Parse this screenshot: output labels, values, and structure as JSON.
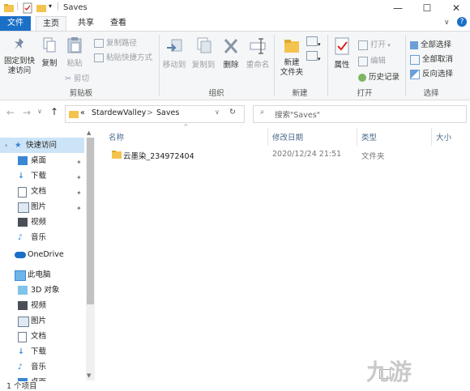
{
  "window": {
    "title": "Saves",
    "controls": {
      "minimize": "—",
      "maximize": "☐",
      "close": "✕"
    }
  },
  "tabs": {
    "file": "文件",
    "home": "主页",
    "share": "共享",
    "view": "查看"
  },
  "ribbon": {
    "clipboard": {
      "pin": "固定到快\n速访问",
      "copy": "复制",
      "paste": "粘贴",
      "copy_path": "复制路径",
      "paste_shortcut": "粘贴快捷方式",
      "cut": "剪切",
      "group": "剪贴板"
    },
    "organize": {
      "move_to": "移动到",
      "copy_to": "复制到",
      "delete": "删除",
      "rename": "重命名",
      "group": "组织"
    },
    "new": {
      "new_folder": "新建\n文件夹",
      "group": "新建"
    },
    "open": {
      "properties": "属性",
      "open": "打开",
      "edit": "编辑",
      "history": "历史记录",
      "group": "打开"
    },
    "select": {
      "select_all": "全部选择",
      "select_none": "全部取消",
      "invert": "反向选择",
      "group": "选择"
    }
  },
  "address": {
    "prefix": "«",
    "crumbs": [
      "StardewValley",
      "Saves"
    ],
    "separator": ">"
  },
  "search": {
    "placeholder": "搜索\"Saves\""
  },
  "nav": {
    "quick_access": "快速访问",
    "quick_items": [
      "桌面",
      "下载",
      "文档",
      "图片",
      "视频",
      "音乐"
    ],
    "onedrive": "OneDrive",
    "this_pc": "此电脑",
    "pc_items": [
      "3D 对象",
      "视频",
      "图片",
      "文档",
      "下载",
      "音乐",
      "桌面"
    ]
  },
  "columns": {
    "name": "名称",
    "modified": "修改日期",
    "type": "类型",
    "size": "大小"
  },
  "files": [
    {
      "name": "云墨染_234972404",
      "modified": "2020/12/24 21:51",
      "type": "文件夹",
      "size": ""
    }
  ],
  "status": {
    "count": "1 个项目"
  },
  "watermark": "九游",
  "colors": {
    "accent": "#1a6fc7",
    "folder": "#f4c34d",
    "selected_nav": "#cce4f7"
  }
}
